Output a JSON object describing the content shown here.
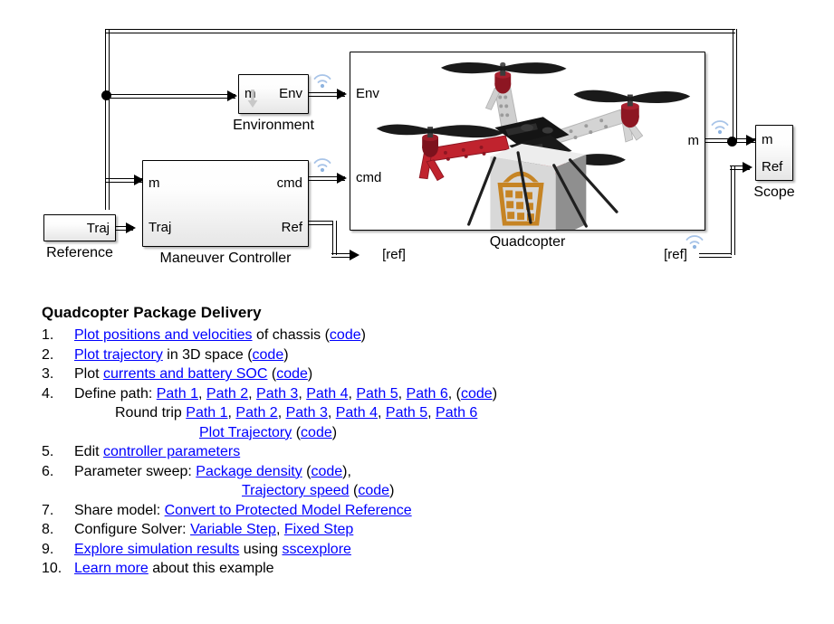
{
  "diagram": {
    "blocks": {
      "environment": {
        "label": "Environment",
        "in_port": "m",
        "out_port": "Env"
      },
      "maneuver_controller": {
        "label": "Maneuver Controller",
        "in_ports": [
          "m",
          "Traj"
        ],
        "out_ports": [
          "cmd",
          "Ref"
        ]
      },
      "reference": {
        "label": "Reference",
        "out_port": "Traj"
      },
      "quadcopter": {
        "label": "Quadcopter",
        "in_ports": [
          "Env",
          "cmd"
        ],
        "out_port": "m"
      },
      "scope": {
        "label": "Scope",
        "in_ports": [
          "m",
          "Ref"
        ]
      },
      "goto_ref": {
        "label": "[ref]"
      },
      "from_ref": {
        "label": "[ref]"
      }
    },
    "colors": {
      "line": "#000000",
      "wireless_icon": "#a8c4e8",
      "block_fill_top": "#ffffff",
      "block_fill_bottom": "#e6e6e6"
    }
  },
  "notes": {
    "title": "Quadcopter Package Delivery",
    "steps": [
      {
        "num": "1.",
        "parts": [
          {
            "t": "link",
            "v": "Plot positions and velocities"
          },
          {
            "t": "text",
            "v": " of chassis ("
          },
          {
            "t": "link",
            "v": "code"
          },
          {
            "t": "text",
            "v": ")"
          }
        ]
      },
      {
        "num": "2.",
        "parts": [
          {
            "t": "link",
            "v": "Plot trajectory"
          },
          {
            "t": "text",
            "v": " in 3D space ("
          },
          {
            "t": "link",
            "v": "code"
          },
          {
            "t": "text",
            "v": ")"
          }
        ]
      },
      {
        "num": "3.",
        "parts": [
          {
            "t": "text",
            "v": "Plot "
          },
          {
            "t": "link",
            "v": "currents and battery SOC"
          },
          {
            "t": "text",
            "v": " ("
          },
          {
            "t": "link",
            "v": "code"
          },
          {
            "t": "text",
            "v": ")"
          }
        ]
      },
      {
        "num": "4.",
        "parts": [
          {
            "t": "text",
            "v": "Define path: "
          },
          {
            "t": "link",
            "v": "Path 1"
          },
          {
            "t": "text",
            "v": ", "
          },
          {
            "t": "link",
            "v": "Path 2"
          },
          {
            "t": "text",
            "v": ", "
          },
          {
            "t": "link",
            "v": "Path 3"
          },
          {
            "t": "text",
            "v": ", "
          },
          {
            "t": "link",
            "v": "Path 4"
          },
          {
            "t": "text",
            "v": ", "
          },
          {
            "t": "link",
            "v": "Path 5"
          },
          {
            "t": "text",
            "v": ", "
          },
          {
            "t": "link",
            "v": "Path 6"
          },
          {
            "t": "text",
            "v": ", ("
          },
          {
            "t": "link",
            "v": "code"
          },
          {
            "t": "text",
            "v": ")"
          }
        ],
        "sublines": [
          {
            "indent": "ind1",
            "parts": [
              {
                "t": "text",
                "v": "Round trip   "
              },
              {
                "t": "link",
                "v": "Path 1"
              },
              {
                "t": "text",
                "v": ", "
              },
              {
                "t": "link",
                "v": "Path 2"
              },
              {
                "t": "text",
                "v": ", "
              },
              {
                "t": "link",
                "v": "Path 3"
              },
              {
                "t": "text",
                "v": ", "
              },
              {
                "t": "link",
                "v": "Path 4"
              },
              {
                "t": "text",
                "v": ", "
              },
              {
                "t": "link",
                "v": "Path 5"
              },
              {
                "t": "text",
                "v": ", "
              },
              {
                "t": "link",
                "v": "Path 6"
              }
            ]
          },
          {
            "indent": "ind2",
            "parts": [
              {
                "t": "link",
                "v": "Plot Trajectory"
              },
              {
                "t": "text",
                "v": " ("
              },
              {
                "t": "link",
                "v": "code"
              },
              {
                "t": "text",
                "v": ")"
              }
            ]
          }
        ]
      },
      {
        "num": "5.",
        "parts": [
          {
            "t": "text",
            "v": "Edit "
          },
          {
            "t": "link",
            "v": "controller parameters"
          }
        ]
      },
      {
        "num": "6.",
        "parts": [
          {
            "t": "text",
            "v": "Parameter sweep: "
          },
          {
            "t": "link",
            "v": "Package density"
          },
          {
            "t": "text",
            "v": " ("
          },
          {
            "t": "link",
            "v": "code"
          },
          {
            "t": "text",
            "v": "),"
          }
        ],
        "sublines": [
          {
            "indent": "ind3",
            "parts": [
              {
                "t": "link",
                "v": "Trajectory speed"
              },
              {
                "t": "text",
                "v": " ("
              },
              {
                "t": "link",
                "v": "code"
              },
              {
                "t": "text",
                "v": ")"
              }
            ]
          }
        ]
      },
      {
        "num": "7.",
        "parts": [
          {
            "t": "text",
            "v": "Share model: "
          },
          {
            "t": "link",
            "v": "Convert to Protected Model Reference"
          }
        ]
      },
      {
        "num": "8.",
        "parts": [
          {
            "t": "text",
            "v": "Configure Solver: "
          },
          {
            "t": "link",
            "v": "Variable Step"
          },
          {
            "t": "text",
            "v": ", "
          },
          {
            "t": "link",
            "v": "Fixed Step"
          }
        ]
      },
      {
        "num": "9.",
        "parts": [
          {
            "t": "link",
            "v": "Explore simulation results"
          },
          {
            "t": "text",
            "v": " using "
          },
          {
            "t": "link",
            "v": "sscexplore"
          }
        ]
      },
      {
        "num": "10.",
        "parts": [
          {
            "t": "link",
            "v": "Learn more"
          },
          {
            "t": "text",
            "v": " about this example"
          }
        ]
      }
    ],
    "link_color": "#0000ff"
  }
}
